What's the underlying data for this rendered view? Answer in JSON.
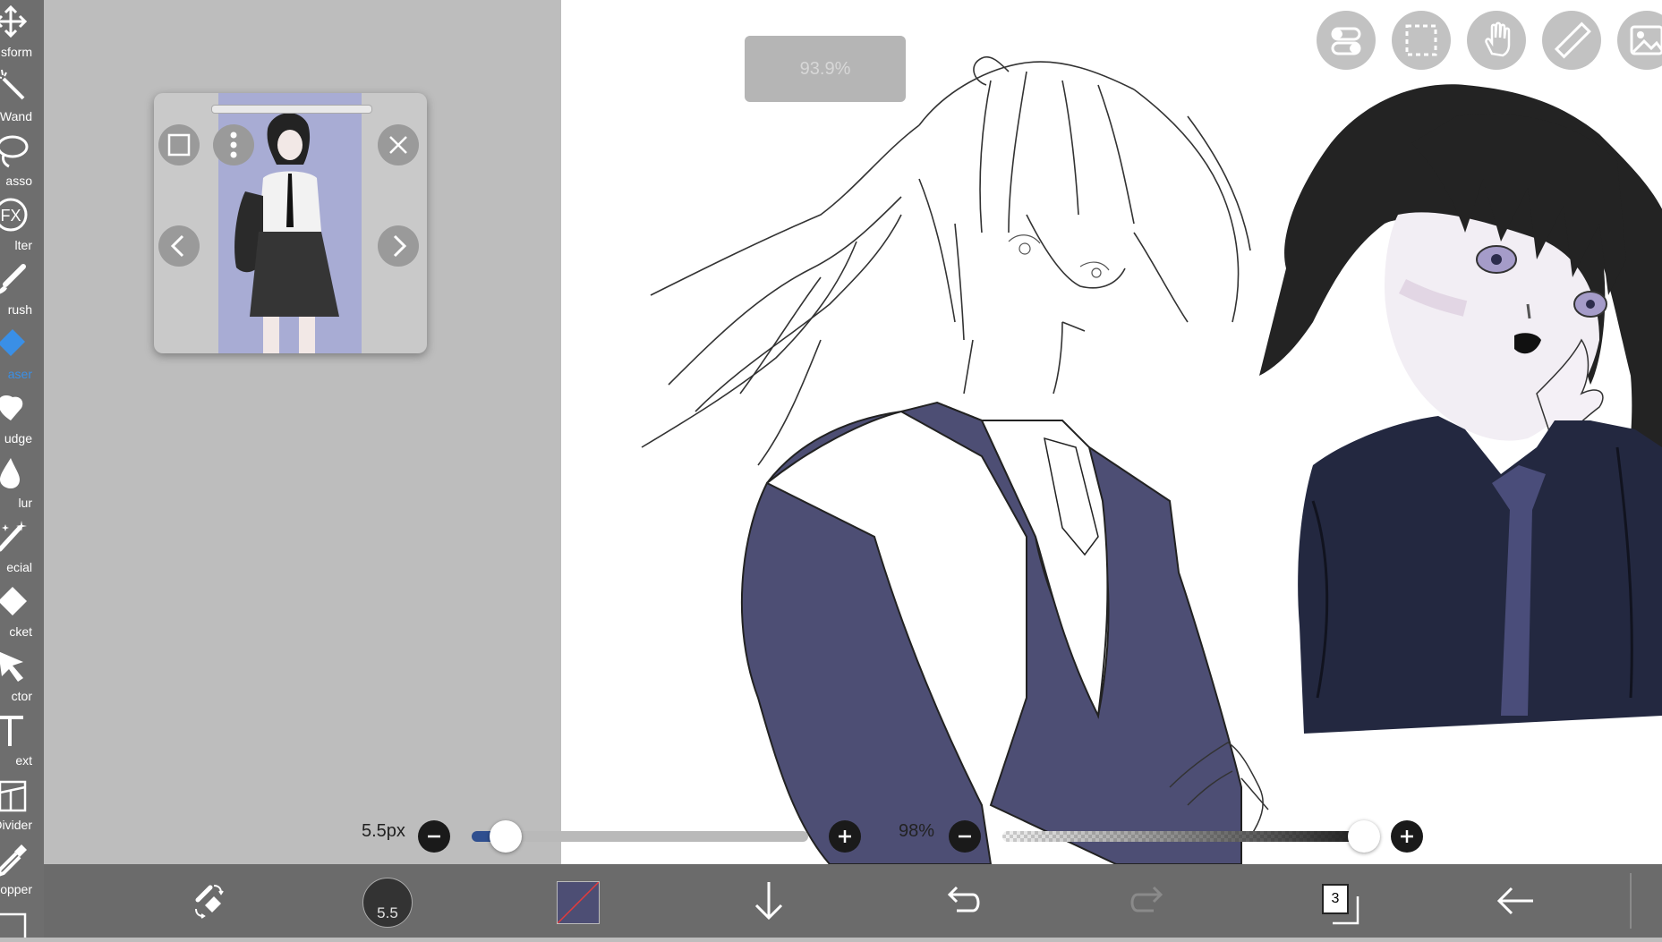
{
  "toolbar": {
    "items": [
      {
        "label": "Transform",
        "visible_label": "sform",
        "icon": "move-arrows-icon"
      },
      {
        "label": "Magic Wand",
        "visible_label": "c Wand",
        "icon": "magic-wand-icon"
      },
      {
        "label": "Lasso",
        "visible_label": "asso",
        "icon": "lasso-icon"
      },
      {
        "label": "Filter",
        "visible_label": "lter",
        "icon": "fx-icon"
      },
      {
        "label": "Brush",
        "visible_label": "rush",
        "icon": "brush-icon"
      },
      {
        "label": "Eraser",
        "visible_label": "aser",
        "icon": "eraser-icon",
        "active": true
      },
      {
        "label": "Smudge",
        "visible_label": "udge",
        "icon": "smudge-icon"
      },
      {
        "label": "Blur",
        "visible_label": "lur",
        "icon": "drop-icon"
      },
      {
        "label": "Special",
        "visible_label": "ecial",
        "icon": "special-brush-icon"
      },
      {
        "label": "Bucket",
        "visible_label": "cket",
        "icon": "bucket-icon"
      },
      {
        "label": "Selector",
        "visible_label": "ctor",
        "icon": "cursor-icon"
      },
      {
        "label": "Text",
        "visible_label": "ext",
        "icon": "text-icon"
      },
      {
        "label": "Frame Divider",
        "visible_label": "Divider",
        "icon": "frame-divider-icon"
      },
      {
        "label": "Eyedropper",
        "visible_label": "ropper",
        "icon": "eyedropper-icon"
      }
    ],
    "active_color": "#3a8fe6"
  },
  "zoom_indicator": {
    "text": "93.9%"
  },
  "reference_window": {
    "buttons": [
      "frame-icon",
      "more-vertical-icon",
      "close-icon",
      "chevron-left-icon",
      "chevron-right-icon"
    ]
  },
  "top_tools": [
    "toggle-icon",
    "selection-rect-icon",
    "hand-icon",
    "ruler-icon",
    "image-icon"
  ],
  "brush_size": {
    "label": "5.5px",
    "value": 5.5,
    "slider_fraction": 0.1
  },
  "opacity": {
    "label": "98%",
    "value": 98,
    "slider_fraction": 0.98
  },
  "bottom_bar": {
    "brush_size_badge": "5.5",
    "layers_count": "3",
    "color": "#4d4e74",
    "icons": [
      "brush-eraser-swap-icon",
      "brush-size-icon",
      "color-swatch",
      "download-icon",
      "undo-icon",
      "redo-icon",
      "layers-icon",
      "back-icon"
    ]
  },
  "colors": {
    "toolbar_bg": "#6e6e6e",
    "canvas_bg": "#ffffff",
    "side_bg": "#bdbdbd",
    "accent": "#3a8fe6",
    "jacket": "#4d4e74"
  }
}
